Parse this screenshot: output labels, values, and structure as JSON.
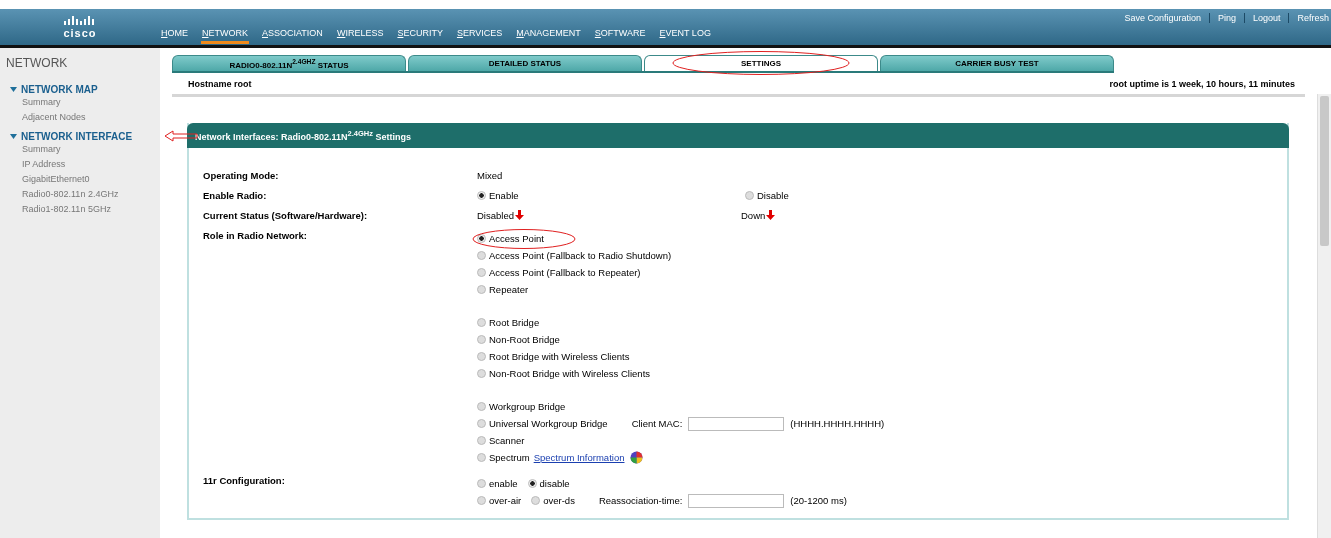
{
  "header": {
    "logo": "cisco",
    "nav": [
      {
        "label": "HOME",
        "selected": false
      },
      {
        "label": "NETWORK",
        "selected": true
      },
      {
        "label": "ASSOCIATION",
        "selected": false
      },
      {
        "label": "WIRELESS",
        "selected": false
      },
      {
        "label": "SECURITY",
        "selected": false
      },
      {
        "label": "SERVICES",
        "selected": false
      },
      {
        "label": "MANAGEMENT",
        "selected": false
      },
      {
        "label": "SOFTWARE",
        "selected": false
      },
      {
        "label": "EVENT LOG",
        "selected": false
      }
    ],
    "links": [
      "Save Configuration",
      "Ping",
      "Logout",
      "Refresh"
    ]
  },
  "sidebar": {
    "title": "NETWORK",
    "groups": [
      {
        "label": "NETWORK MAP",
        "expanded": true,
        "children": [
          "Summary",
          "Adjacent Nodes"
        ]
      },
      {
        "label": "NETWORK INTERFACE",
        "expanded": true,
        "children": [
          "Summary",
          "IP Address",
          "GigabitEthernet0",
          "Radio0-802.11n 2.4GHz",
          "Radio1-802.11n 5GHz"
        ]
      }
    ]
  },
  "tabs": [
    {
      "label": "RADIO0-802.11N$^{2.4GHZ}$ STATUS",
      "selected": false
    },
    {
      "label": "DETAILED STATUS",
      "selected": false
    },
    {
      "label": "SETTINGS",
      "selected": true
    },
    {
      "label": "CARRIER BUSY TEST",
      "selected": false
    }
  ],
  "hostname": "Hostname root",
  "uptime": "root uptime is 1 week, 10 hours, 11 minutes",
  "panel": {
    "title": "Network Interfaces: Radio0-802.11N$^{2.4GHz}$ Settings",
    "rows": [
      {
        "kind": "text",
        "label": "Operating Mode:",
        "value": "Mixed"
      },
      {
        "kind": "radio_pair",
        "label": "Enable Radio:",
        "options": [
          {
            "label": "Enable",
            "selected": true
          },
          {
            "label": "Disable",
            "selected": false
          }
        ]
      },
      {
        "kind": "status",
        "label": "Current Status (Software/Hardware):",
        "values": [
          "Disabled",
          "Down"
        ]
      },
      {
        "kind": "radio_groups",
        "label": "Role in Radio Network:",
        "groups": [
          {
            "lines": [
              {
                "options": [
                  {
                    "label": "Access Point",
                    "selected": true
                  }
                ]
              },
              {
                "options": [
                  {
                    "label": "Access Point (Fallback to Radio Shutdown)",
                    "selected": false
                  }
                ]
              },
              {
                "options": [
                  {
                    "label": "Access Point (Fallback to Repeater)",
                    "selected": false
                  }
                ]
              },
              {
                "options": [
                  {
                    "label": "Repeater",
                    "selected": false
                  }
                ]
              }
            ]
          },
          {
            "lines": [
              {
                "options": [
                  {
                    "label": "Root Bridge",
                    "selected": false
                  }
                ]
              },
              {
                "options": [
                  {
                    "label": "Non-Root Bridge",
                    "selected": false
                  }
                ]
              },
              {
                "options": [
                  {
                    "label": "Root Bridge with Wireless Clients",
                    "selected": false
                  }
                ]
              },
              {
                "options": [
                  {
                    "label": "Non-Root Bridge with Wireless Clients",
                    "selected": false
                  }
                ]
              }
            ]
          },
          {
            "lines": [
              {
                "options": [
                  {
                    "label": "Workgroup Bridge",
                    "selected": false
                  }
                ]
              },
              {
                "options": [
                  {
                    "label": "Universal Workgroup Bridge",
                    "selected": false
                  }
                ],
                "field": {
                  "label": "Client MAC:",
                  "hint": "(HHHH.HHHH.HHHH)"
                }
              },
              {
                "options": [
                  {
                    "label": "Scanner",
                    "selected": false
                  }
                ]
              },
              {
                "options": [
                  {
                    "label": "Spectrum",
                    "selected": false
                  }
                ],
                "link": "Spectrum Information"
              }
            ]
          }
        ]
      },
      {
        "kind": "radio_groups",
        "label": "11r Configuration:",
        "groups": [
          {
            "lines": [
              {
                "options": [
                  {
                    "label": "enable",
                    "selected": false
                  },
                  {
                    "label": "disable",
                    "selected": true
                  }
                ]
              },
              {
                "options": [
                  {
                    "label": "over-air",
                    "selected": false
                  },
                  {
                    "label": "over-ds",
                    "selected": false
                  }
                ],
                "field": {
                  "label": "Reassociation-time:",
                  "hint": "(20-1200 ms)"
                }
              }
            ]
          }
        ]
      }
    ]
  }
}
